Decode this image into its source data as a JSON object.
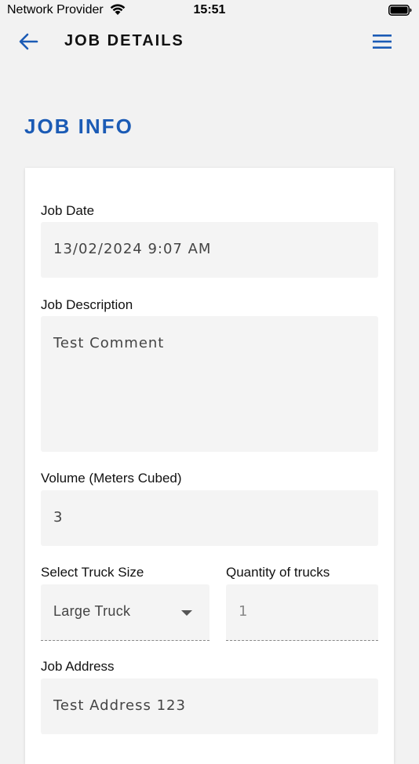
{
  "status_bar": {
    "carrier": "Network Provider",
    "time": "15:51"
  },
  "header": {
    "title": "JOB DETAILS",
    "back_icon": "arrow-left-icon",
    "menu_icon": "hamburger-menu-icon"
  },
  "section": {
    "title": "JOB INFO"
  },
  "form": {
    "job_date": {
      "label": "Job Date",
      "value": "13/02/2024 9:07 AM"
    },
    "job_description": {
      "label": "Job Description",
      "value": "Test Comment"
    },
    "volume": {
      "label": "Volume (Meters Cubed)",
      "value": "3"
    },
    "truck_size": {
      "label": "Select Truck Size",
      "value": "Large Truck"
    },
    "truck_quantity": {
      "label": "Quantity of trucks",
      "value": "1"
    },
    "job_address": {
      "label": "Job Address",
      "value": "Test Address 123"
    }
  },
  "colors": {
    "accent": "#1b5bb5",
    "background": "#f2f2f2",
    "field_background": "#f4f4f4"
  }
}
